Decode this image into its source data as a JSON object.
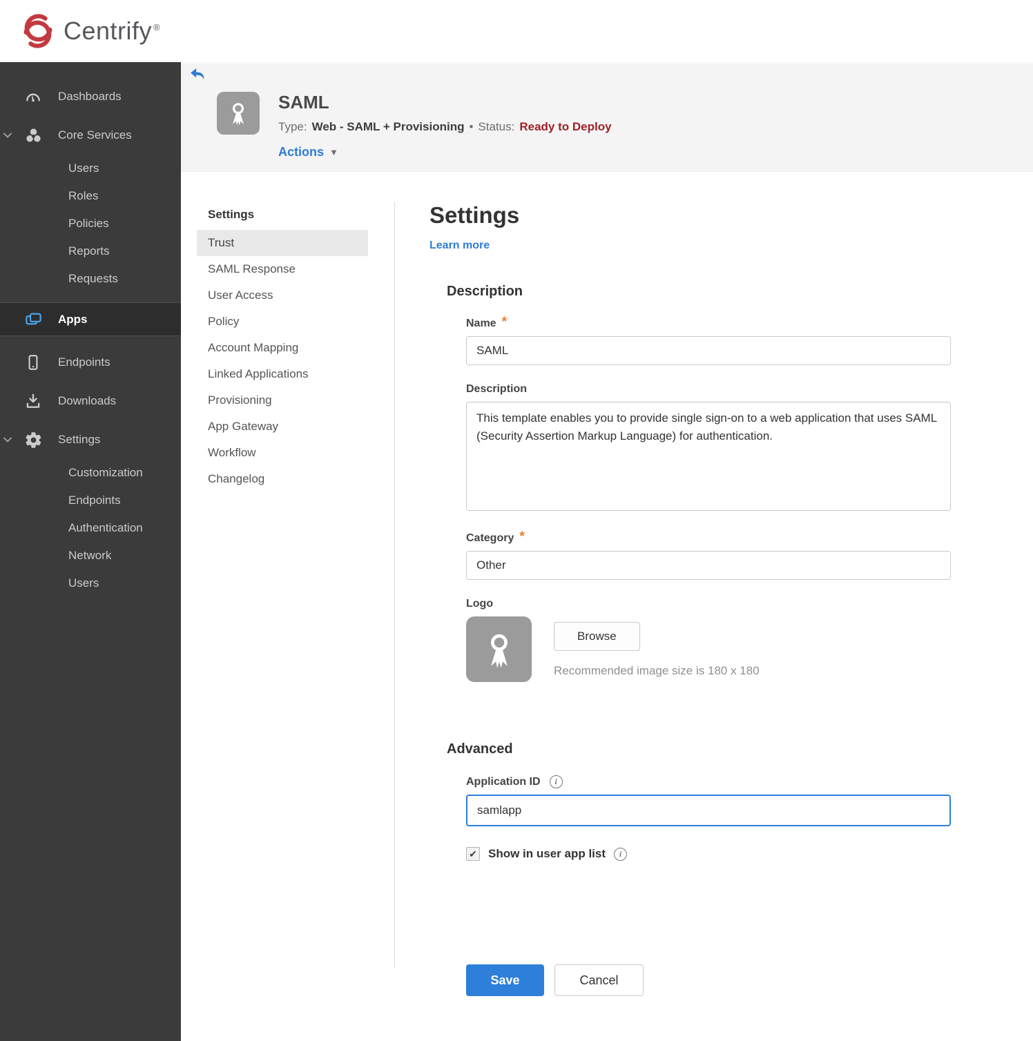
{
  "brand": {
    "name": "Centrify",
    "reg_mark": "®",
    "logo_color": "#c23a40"
  },
  "sidebar": {
    "items": [
      {
        "label": "Dashboards",
        "icon": "gauge-icon",
        "level": 0
      },
      {
        "label": "Core Services",
        "icon": "core-services-icon",
        "level": 0,
        "expanded": true
      },
      {
        "label": "Users",
        "level": 1
      },
      {
        "label": "Roles",
        "level": 1
      },
      {
        "label": "Policies",
        "level": 1
      },
      {
        "label": "Reports",
        "level": 1
      },
      {
        "label": "Requests",
        "level": 1
      },
      {
        "label": "Apps",
        "icon": "apps-icon",
        "level": 0,
        "active": true
      },
      {
        "label": "Endpoints",
        "icon": "phone-icon",
        "level": 0
      },
      {
        "label": "Downloads",
        "icon": "download-icon",
        "level": 0
      },
      {
        "label": "Settings",
        "icon": "gear-icon",
        "level": 0,
        "expanded": true
      },
      {
        "label": "Customization",
        "level": 1
      },
      {
        "label": "Endpoints",
        "level": 1
      },
      {
        "label": "Authentication",
        "level": 1
      },
      {
        "label": "Network",
        "level": 1
      },
      {
        "label": "Users",
        "level": 1
      }
    ]
  },
  "header": {
    "title": "SAML",
    "type_label": "Type:",
    "type_value": "Web - SAML + Provisioning",
    "separator": "•",
    "status_label": "Status:",
    "status_value": "Ready to Deploy",
    "status_color": "#9f2026",
    "actions_label": "Actions"
  },
  "subnav": {
    "heading": "Settings",
    "active_item": "Trust",
    "items": [
      "Trust",
      "SAML Response",
      "User Access",
      "Policy",
      "Account Mapping",
      "Linked Applications",
      "Provisioning",
      "App Gateway",
      "Workflow",
      "Changelog"
    ]
  },
  "main": {
    "title": "Settings",
    "learn_more_label": "Learn more",
    "required_marker": "*",
    "description_section": {
      "heading": "Description",
      "name_label": "Name",
      "name_value": "SAML",
      "description_label": "Description",
      "description_value": "This template enables you to provide single sign-on to a web application that uses SAML (Security Assertion Markup Language) for authentication.",
      "category_label": "Category",
      "category_value": "Other",
      "logo_label": "Logo",
      "browse_label": "Browse",
      "logo_hint": "Recommended image size is 180 x 180"
    },
    "advanced_section": {
      "heading": "Advanced",
      "application_id_label": "Application ID",
      "application_id_value": "samlapp",
      "show_in_user_app_list_label": "Show in user app list",
      "show_in_user_app_list_checked": true
    },
    "save_label": "Save",
    "cancel_label": "Cancel"
  },
  "colors": {
    "accent_blue": "#2e7cd6",
    "save_blue": "#2e7fd9",
    "status_red": "#9f2026",
    "required_orange": "#ee7b30",
    "sidebar_bg": "#3b3b3b",
    "header_strip_bg": "#f4f4f4",
    "apps_icon_blue": "#4aa3e8"
  }
}
